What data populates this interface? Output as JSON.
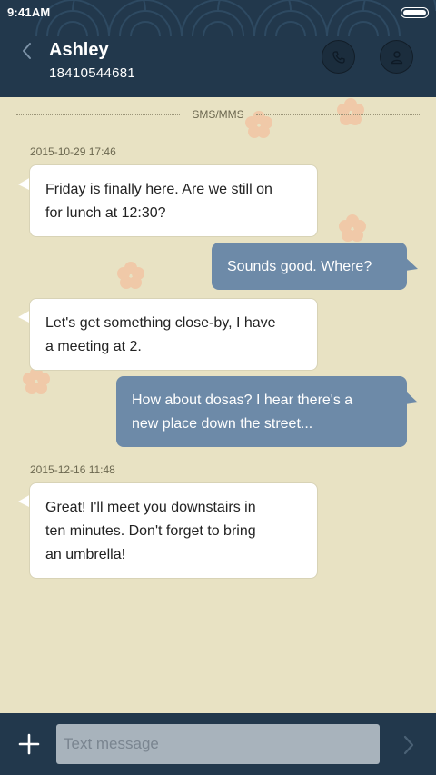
{
  "status_bar": {
    "time": "9:41AM",
    "battery_icon": "battery-icon"
  },
  "header": {
    "contact_name": "Ashley",
    "contact_number": "18410544681",
    "back_icon": "chevron-left-icon",
    "call_icon": "phone-icon",
    "profile_icon": "person-icon"
  },
  "thread": {
    "channel_label": "SMS/MMS",
    "messages": [
      {
        "timestamp": "2015-10-29 17:46",
        "direction": "incoming",
        "lines": [
          "Friday is finally here. Are we still on",
          "for lunch at 12:30?"
        ]
      },
      {
        "direction": "outgoing",
        "lines": [
          "Sounds good. Where?"
        ]
      },
      {
        "direction": "incoming",
        "lines": [
          "Let's get something close-by, I have",
          "a meeting at 2."
        ]
      },
      {
        "direction": "outgoing",
        "lines": [
          "How about dosas? I hear there's a",
          "new place down the street..."
        ]
      },
      {
        "timestamp": "2015-12-16 11:48",
        "direction": "incoming",
        "lines": [
          "Great! I'll meet you downstairs in",
          "ten minutes. Don't forget to bring",
          "an umbrella!"
        ]
      }
    ]
  },
  "composer": {
    "placeholder": "Text message",
    "value": "",
    "add_icon": "plus-icon",
    "send_icon": "chevron-right-icon"
  },
  "colors": {
    "header_bg": "#22384c",
    "chat_bg": "#e8e2c3",
    "incoming_bubble": "#ffffff",
    "outgoing_bubble": "#6d8aa8",
    "flower": "#f0c9a8"
  }
}
